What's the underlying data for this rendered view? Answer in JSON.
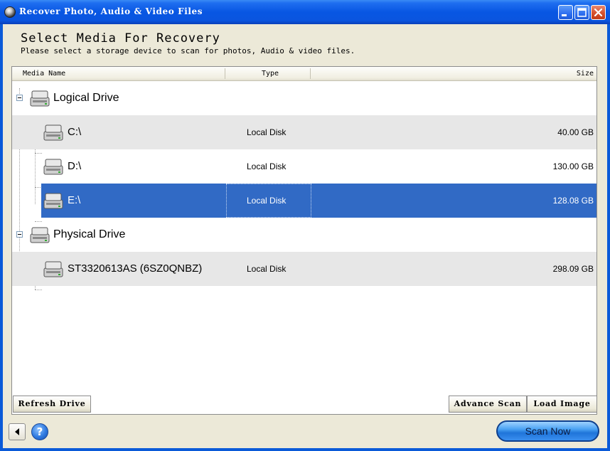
{
  "window": {
    "title": "Recover Photo, Audio & Video Files"
  },
  "header": {
    "title": "Select Media For Recovery",
    "subtitle": "Please select a storage device to scan for photos, Audio & video files."
  },
  "columns": {
    "name": "Media Name",
    "type": "Type",
    "size": "Size"
  },
  "groups": [
    {
      "label": "Logical Drive",
      "items": [
        {
          "name": "C:\\",
          "type": "Local Disk",
          "size": "40.00 GB",
          "selected": false
        },
        {
          "name": "D:\\",
          "type": "Local Disk",
          "size": "130.00 GB",
          "selected": false
        },
        {
          "name": "E:\\",
          "type": "Local Disk",
          "size": "128.08 GB",
          "selected": true
        }
      ]
    },
    {
      "label": "Physical Drive",
      "items": [
        {
          "name": "ST3320613AS (6SZ0QNBZ)",
          "type": "Local Disk",
          "size": "298.09 GB",
          "selected": false
        }
      ]
    }
  ],
  "buttons": {
    "refresh": "Refresh Drive",
    "advance_scan": "Advance Scan",
    "load_image": "Load Image",
    "help": "?",
    "scan_now": "Scan Now"
  },
  "colors": {
    "title_bar": "#0a55df",
    "selection": "#316ac5",
    "window_bg": "#ece9d8",
    "scan_button": "#1f74d9"
  },
  "icons": {
    "app": "app-globe-icon",
    "drive": "hard-drive-icon",
    "back": "back-arrow-icon",
    "help": "help-icon",
    "minimize": "minimize-icon",
    "maximize": "maximize-icon",
    "close": "close-icon"
  }
}
